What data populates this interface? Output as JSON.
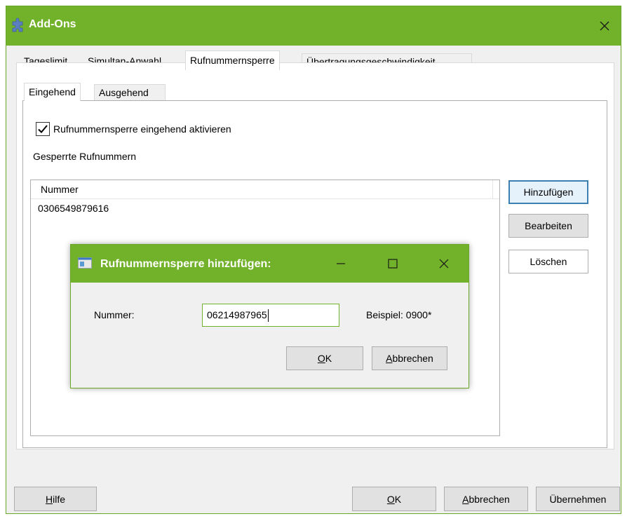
{
  "window": {
    "title": "Add-Ons",
    "tabs": [
      "Tageslimit",
      "Simultan-Anwahl",
      "Rufnummernsperre",
      "Übertragungsgeschwindigkeit"
    ],
    "active_tab": "Rufnummernsperre"
  },
  "subtabs": [
    "Eingehend",
    "Ausgehend"
  ],
  "active_subtab": "Eingehend",
  "checkbox": {
    "label": "Rufnummernsperre eingehend aktivieren",
    "checked": true
  },
  "list": {
    "label": "Gesperrte Rufnummern",
    "column": "Nummer",
    "rows": [
      "0306549879616"
    ]
  },
  "side_buttons": {
    "add": "Hinzufügen",
    "edit": "Bearbeiten",
    "delete": "Löschen"
  },
  "dialog": {
    "title": "Rufnummernsperre hinzufügen:",
    "field_label": "Nummer:",
    "field_value": "06214987965",
    "hint": "Beispiel: 0900*",
    "ok_underline": "O",
    "ok_rest": "K",
    "cancel_underline": "A",
    "cancel_rest": "bbrechen"
  },
  "footer": {
    "help_underline": "H",
    "help_rest": "ilfe",
    "ok_underline": "O",
    "ok_rest": "K",
    "cancel_underline": "A",
    "cancel_rest": "bbrechen",
    "apply": "Übernehmen"
  },
  "colors": {
    "titlebar": "#72b12a",
    "accent_border": "#3c7fb1"
  },
  "icons": [
    "puzzle-icon",
    "close-icon",
    "window-icon",
    "minimize-icon",
    "maximize-icon",
    "checkmark-icon"
  ]
}
